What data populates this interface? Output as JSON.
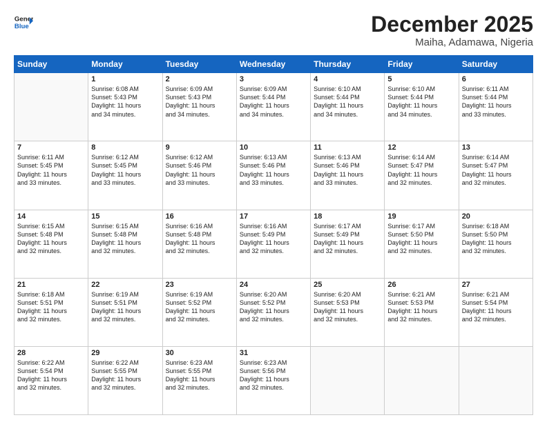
{
  "header": {
    "logo_line1": "General",
    "logo_line2": "Blue",
    "month": "December 2025",
    "location": "Maiha, Adamawa, Nigeria"
  },
  "weekdays": [
    "Sunday",
    "Monday",
    "Tuesday",
    "Wednesday",
    "Thursday",
    "Friday",
    "Saturday"
  ],
  "weeks": [
    [
      {
        "day": "",
        "info": ""
      },
      {
        "day": "1",
        "info": "Sunrise: 6:08 AM\nSunset: 5:43 PM\nDaylight: 11 hours\nand 34 minutes."
      },
      {
        "day": "2",
        "info": "Sunrise: 6:09 AM\nSunset: 5:43 PM\nDaylight: 11 hours\nand 34 minutes."
      },
      {
        "day": "3",
        "info": "Sunrise: 6:09 AM\nSunset: 5:44 PM\nDaylight: 11 hours\nand 34 minutes."
      },
      {
        "day": "4",
        "info": "Sunrise: 6:10 AM\nSunset: 5:44 PM\nDaylight: 11 hours\nand 34 minutes."
      },
      {
        "day": "5",
        "info": "Sunrise: 6:10 AM\nSunset: 5:44 PM\nDaylight: 11 hours\nand 34 minutes."
      },
      {
        "day": "6",
        "info": "Sunrise: 6:11 AM\nSunset: 5:44 PM\nDaylight: 11 hours\nand 33 minutes."
      }
    ],
    [
      {
        "day": "7",
        "info": "Sunrise: 6:11 AM\nSunset: 5:45 PM\nDaylight: 11 hours\nand 33 minutes."
      },
      {
        "day": "8",
        "info": "Sunrise: 6:12 AM\nSunset: 5:45 PM\nDaylight: 11 hours\nand 33 minutes."
      },
      {
        "day": "9",
        "info": "Sunrise: 6:12 AM\nSunset: 5:46 PM\nDaylight: 11 hours\nand 33 minutes."
      },
      {
        "day": "10",
        "info": "Sunrise: 6:13 AM\nSunset: 5:46 PM\nDaylight: 11 hours\nand 33 minutes."
      },
      {
        "day": "11",
        "info": "Sunrise: 6:13 AM\nSunset: 5:46 PM\nDaylight: 11 hours\nand 33 minutes."
      },
      {
        "day": "12",
        "info": "Sunrise: 6:14 AM\nSunset: 5:47 PM\nDaylight: 11 hours\nand 32 minutes."
      },
      {
        "day": "13",
        "info": "Sunrise: 6:14 AM\nSunset: 5:47 PM\nDaylight: 11 hours\nand 32 minutes."
      }
    ],
    [
      {
        "day": "14",
        "info": "Sunrise: 6:15 AM\nSunset: 5:48 PM\nDaylight: 11 hours\nand 32 minutes."
      },
      {
        "day": "15",
        "info": "Sunrise: 6:15 AM\nSunset: 5:48 PM\nDaylight: 11 hours\nand 32 minutes."
      },
      {
        "day": "16",
        "info": "Sunrise: 6:16 AM\nSunset: 5:48 PM\nDaylight: 11 hours\nand 32 minutes."
      },
      {
        "day": "17",
        "info": "Sunrise: 6:16 AM\nSunset: 5:49 PM\nDaylight: 11 hours\nand 32 minutes."
      },
      {
        "day": "18",
        "info": "Sunrise: 6:17 AM\nSunset: 5:49 PM\nDaylight: 11 hours\nand 32 minutes."
      },
      {
        "day": "19",
        "info": "Sunrise: 6:17 AM\nSunset: 5:50 PM\nDaylight: 11 hours\nand 32 minutes."
      },
      {
        "day": "20",
        "info": "Sunrise: 6:18 AM\nSunset: 5:50 PM\nDaylight: 11 hours\nand 32 minutes."
      }
    ],
    [
      {
        "day": "21",
        "info": "Sunrise: 6:18 AM\nSunset: 5:51 PM\nDaylight: 11 hours\nand 32 minutes."
      },
      {
        "day": "22",
        "info": "Sunrise: 6:19 AM\nSunset: 5:51 PM\nDaylight: 11 hours\nand 32 minutes."
      },
      {
        "day": "23",
        "info": "Sunrise: 6:19 AM\nSunset: 5:52 PM\nDaylight: 11 hours\nand 32 minutes."
      },
      {
        "day": "24",
        "info": "Sunrise: 6:20 AM\nSunset: 5:52 PM\nDaylight: 11 hours\nand 32 minutes."
      },
      {
        "day": "25",
        "info": "Sunrise: 6:20 AM\nSunset: 5:53 PM\nDaylight: 11 hours\nand 32 minutes."
      },
      {
        "day": "26",
        "info": "Sunrise: 6:21 AM\nSunset: 5:53 PM\nDaylight: 11 hours\nand 32 minutes."
      },
      {
        "day": "27",
        "info": "Sunrise: 6:21 AM\nSunset: 5:54 PM\nDaylight: 11 hours\nand 32 minutes."
      }
    ],
    [
      {
        "day": "28",
        "info": "Sunrise: 6:22 AM\nSunset: 5:54 PM\nDaylight: 11 hours\nand 32 minutes."
      },
      {
        "day": "29",
        "info": "Sunrise: 6:22 AM\nSunset: 5:55 PM\nDaylight: 11 hours\nand 32 minutes."
      },
      {
        "day": "30",
        "info": "Sunrise: 6:23 AM\nSunset: 5:55 PM\nDaylight: 11 hours\nand 32 minutes."
      },
      {
        "day": "31",
        "info": "Sunrise: 6:23 AM\nSunset: 5:56 PM\nDaylight: 11 hours\nand 32 minutes."
      },
      {
        "day": "",
        "info": ""
      },
      {
        "day": "",
        "info": ""
      },
      {
        "day": "",
        "info": ""
      }
    ]
  ]
}
